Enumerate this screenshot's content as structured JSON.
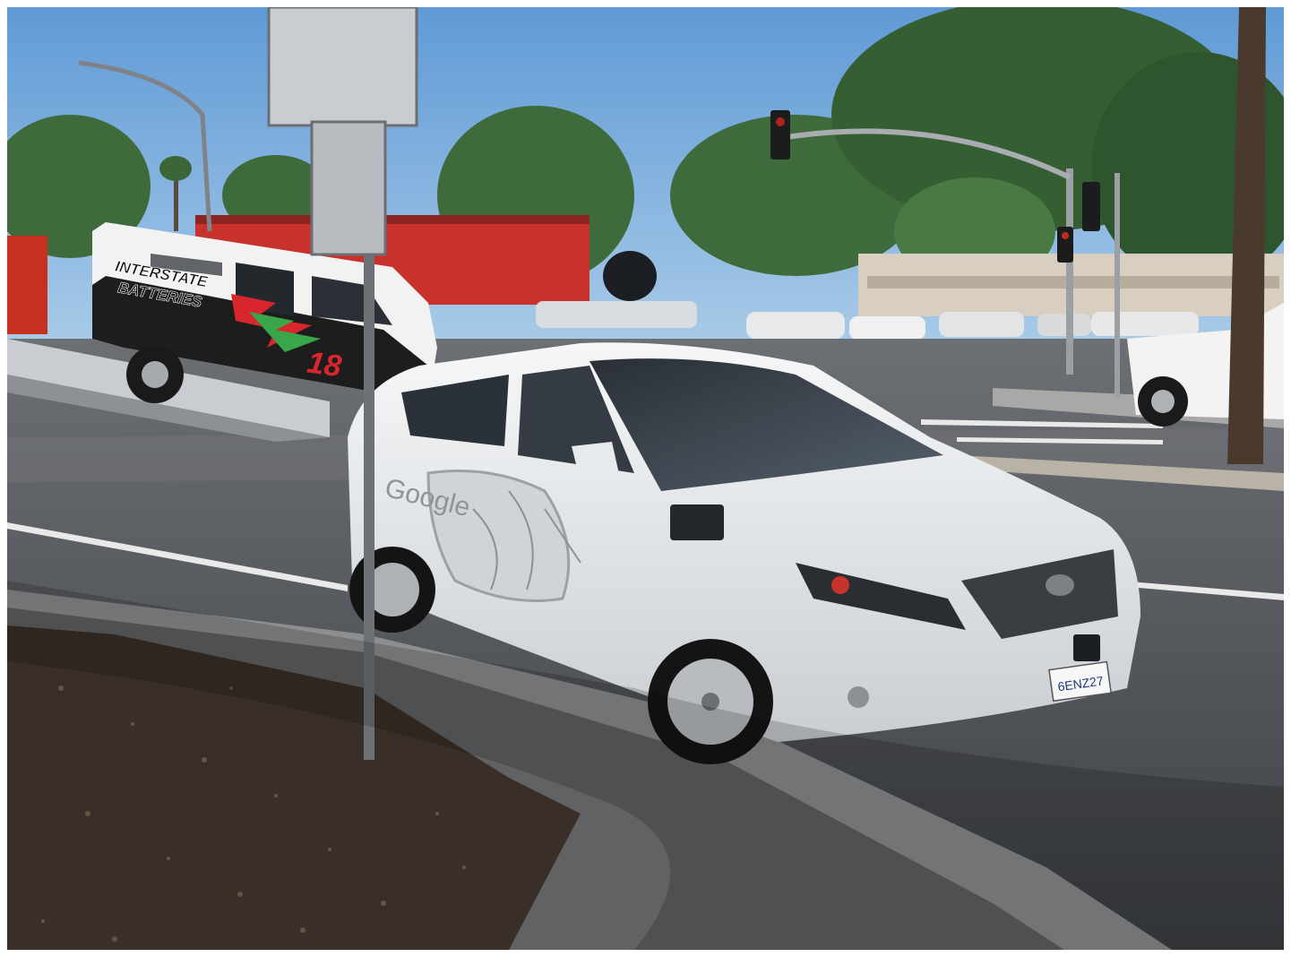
{
  "photo": {
    "van_text_line1": "INTERSTATE",
    "van_text_line2": "BATTERIES",
    "van_number": "18",
    "car_door_text": "Google",
    "plate_text": "6ENZ27"
  },
  "colors": {
    "sky": "#6fa6dc",
    "road": "#4a4d52",
    "car_body": "#eef0f2",
    "van_body": "#f2f2f2",
    "van_graphic_red": "#d8262c",
    "van_graphic_green": "#3aa64a",
    "foliage": "#3d6a3a",
    "mulch": "#3a2f28"
  }
}
